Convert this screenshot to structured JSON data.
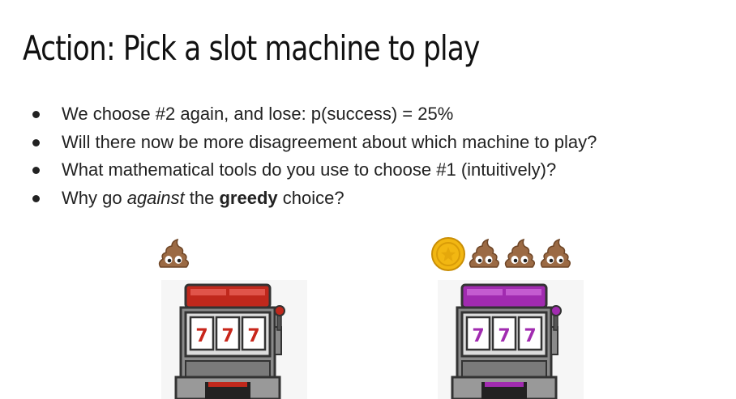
{
  "slide": {
    "title": "Action: Pick a slot machine to play",
    "bullets": [
      {
        "parts": [
          {
            "text": "We choose #2 again, and lose: p(success) = 25%",
            "style": "normal"
          }
        ]
      },
      {
        "parts": [
          {
            "text": "Will there now be more disagreement about which machine to play?",
            "style": "normal"
          }
        ]
      },
      {
        "parts": [
          {
            "text": "What mathematical tools do you use to choose #1 (intuitively)?",
            "style": "normal"
          }
        ]
      },
      {
        "parts": [
          {
            "text": "Why go ",
            "style": "normal"
          },
          {
            "text": "against",
            "style": "italic"
          },
          {
            "text": " the ",
            "style": "normal"
          },
          {
            "text": "greedy",
            "style": "bold"
          },
          {
            "text": " choice?",
            "style": "normal"
          }
        ]
      }
    ]
  },
  "machines": [
    {
      "name": "machine-1",
      "accent": "#c0281c",
      "accent_dark": "#8e1a12",
      "reel_symbols": [
        "7",
        "7",
        "7"
      ],
      "outcomes": [
        "poop"
      ]
    },
    {
      "name": "machine-2",
      "accent": "#a12bb0",
      "accent_dark": "#6e1a7a",
      "reel_symbols": [
        "7",
        "7",
        "7"
      ],
      "outcomes": [
        "coin",
        "poop",
        "poop",
        "poop"
      ]
    }
  ],
  "colors": {
    "reel_seven": "#c8261b",
    "coin": "#f2b712",
    "poop": "#9b6a44",
    "machine_body": "#7d7d7d"
  }
}
